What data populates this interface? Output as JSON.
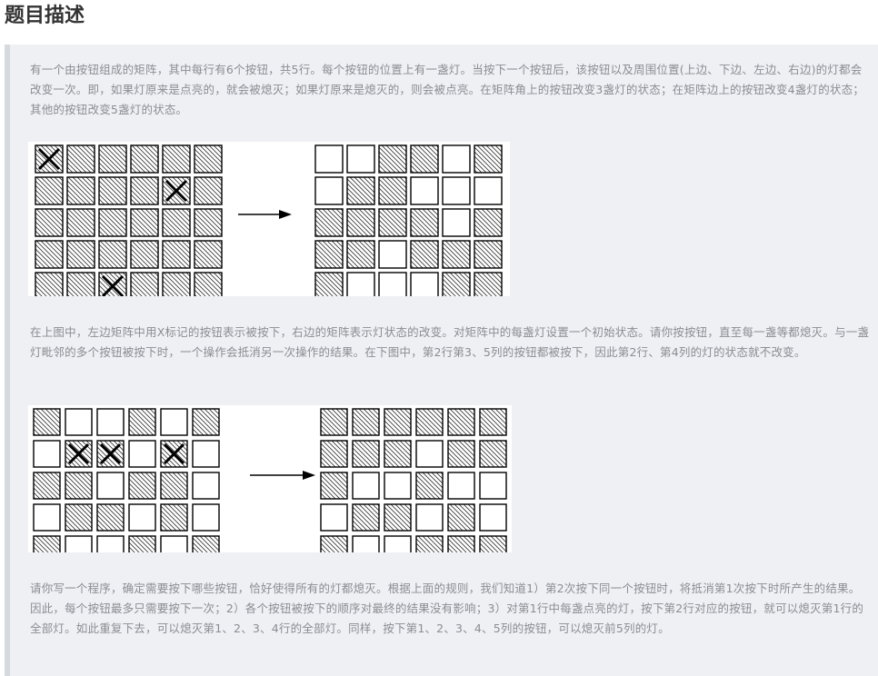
{
  "heading": "题目描述",
  "paragraphs": {
    "p1": "有一个由按钮组成的矩阵，其中每行有6个按钮，共5行。每个按钮的位置上有一盏灯。当按下一个按钮后，该按钮以及周围位置(上边、下边、左边、右边)的灯都会改变一次。即，如果灯原来是点亮的，就会被熄灭；如果灯原来是熄灭的，则会被点亮。在矩阵角上的按钮改变3盏灯的状态；在矩阵边上的按钮改变4盏灯的状态；其他的按钮改变5盏灯的状态。",
    "p2": "在上图中，左边矩阵中用X标记的按钮表示被按下，右边的矩阵表示灯状态的改变。对矩阵中的每盏灯设置一个初始状态。请你按按钮，直至每一盏等都熄灭。与一盏灯毗邻的多个按钮被按下时，一个操作会抵消另一次操作的结果。在下图中，第2行第3、5列的按钮都被按下，因此第2行、第4列的灯的状态就不改变。",
    "p3": "请你写一个程序，确定需要按下哪些按钮，恰好使得所有的灯都熄灭。根据上面的规则，我们知道1）第2次按下同一个按钮时，将抵消第1次按下时所产生的结果。因此，每个按钮最多只需要按下一次；2）各个按钮被按下的顺序对最终的结果没有影响；3）对第1行中每盏点亮的灯，按下第2行对应的按钮，就可以熄灭第1行的全部灯。如此重复下去，可以熄灭第1、2、3、4行的全部灯。同样，按下第1、2、3、4、5列的按钮，可以熄灭前5列的灯。"
  },
  "figures": [
    {
      "left": [
        [
          1,
          1,
          1,
          1,
          1,
          1
        ],
        [
          1,
          1,
          1,
          1,
          1,
          1
        ],
        [
          1,
          1,
          1,
          1,
          1,
          1
        ],
        [
          1,
          1,
          1,
          1,
          1,
          1
        ],
        [
          1,
          1,
          1,
          1,
          1,
          1
        ]
      ],
      "pressed": [
        [
          0,
          0
        ],
        [
          1,
          4
        ],
        [
          4,
          2
        ]
      ],
      "right": [
        [
          0,
          0,
          1,
          1,
          0,
          1
        ],
        [
          0,
          1,
          1,
          0,
          0,
          0
        ],
        [
          1,
          1,
          1,
          1,
          0,
          1
        ],
        [
          1,
          1,
          0,
          1,
          1,
          1
        ],
        [
          1,
          0,
          0,
          0,
          1,
          1
        ]
      ]
    },
    {
      "left": [
        [
          1,
          0,
          0,
          1,
          0,
          1
        ],
        [
          0,
          1,
          1,
          0,
          1,
          0
        ],
        [
          1,
          1,
          0,
          1,
          1,
          0
        ],
        [
          0,
          1,
          1,
          0,
          1,
          0
        ],
        [
          1,
          0,
          0,
          1,
          0,
          1
        ]
      ],
      "pressed": [
        [
          1,
          1
        ],
        [
          1,
          2
        ],
        [
          1,
          4
        ]
      ],
      "right": [
        [
          1,
          1,
          1,
          1,
          1,
          1
        ],
        [
          1,
          1,
          1,
          0,
          1,
          1
        ],
        [
          1,
          0,
          0,
          1,
          0,
          0
        ],
        [
          0,
          1,
          1,
          0,
          1,
          0
        ],
        [
          1,
          0,
          0,
          1,
          1,
          1
        ]
      ]
    }
  ]
}
